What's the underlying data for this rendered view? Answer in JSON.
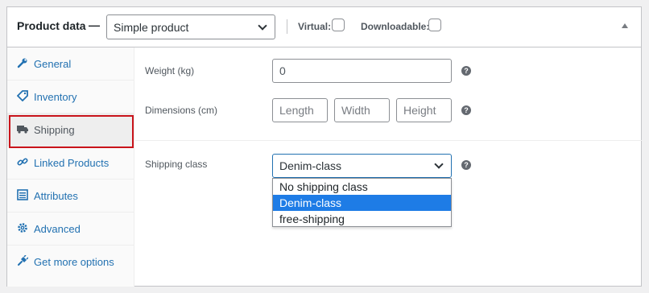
{
  "header": {
    "title": "Product data",
    "dash": "—",
    "product_type": "Simple product",
    "virtual_label": "Virtual:",
    "downloadable_label": "Downloadable:"
  },
  "sidebar": {
    "items": [
      {
        "label": "General",
        "icon": "wrench-icon"
      },
      {
        "label": "Inventory",
        "icon": "tag-icon"
      },
      {
        "label": "Shipping",
        "icon": "truck-icon",
        "active": true
      },
      {
        "label": "Linked Products",
        "icon": "link-icon"
      },
      {
        "label": "Attributes",
        "icon": "list-icon"
      },
      {
        "label": "Advanced",
        "icon": "gear-icon"
      },
      {
        "label": "Get more options",
        "icon": "plugin-icon"
      }
    ]
  },
  "shipping": {
    "weight_label": "Weight (kg)",
    "weight_value": "0",
    "dimensions_label": "Dimensions (cm)",
    "length_placeholder": "Length",
    "width_placeholder": "Width",
    "height_placeholder": "Height",
    "class_label": "Shipping class",
    "class_value": "Denim-class",
    "class_options": [
      "No shipping class",
      "Denim-class",
      "free-shipping"
    ],
    "help_glyph": "?"
  },
  "colors": {
    "link": "#2271b1",
    "highlight_border": "#c9141b",
    "selected_option": "#1e7ce6"
  }
}
